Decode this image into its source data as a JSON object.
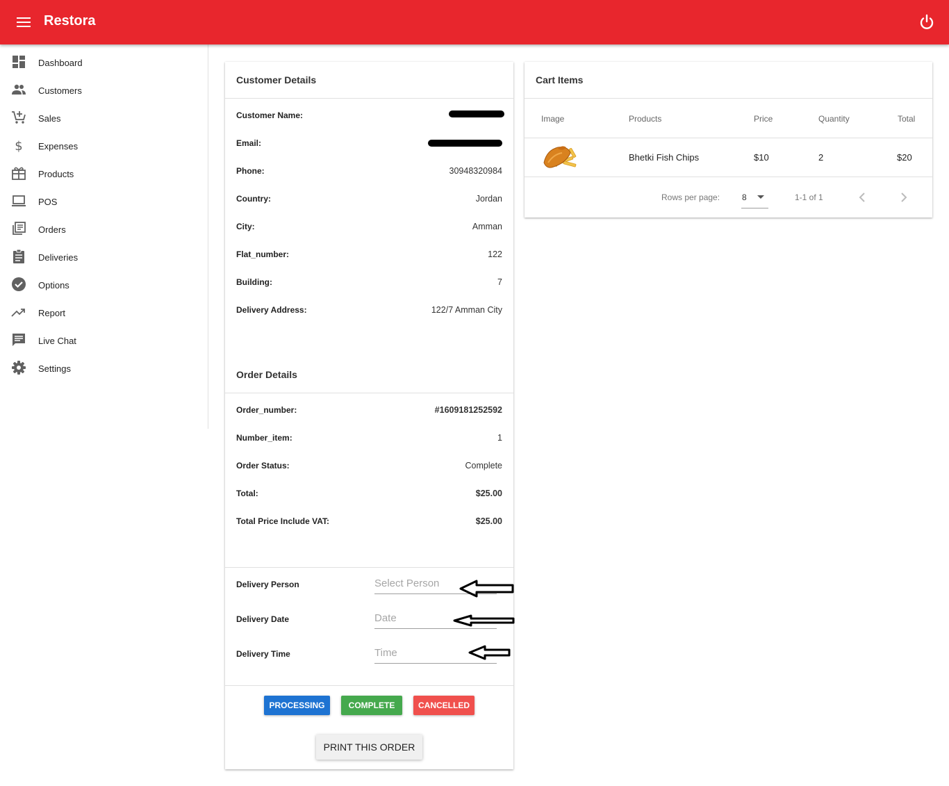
{
  "app": {
    "title": "Restora",
    "icons": {
      "menu": "menu-icon",
      "power": "power-icon"
    }
  },
  "sidebar": {
    "items": [
      {
        "label": "Dashboard",
        "icon": "dashboard-icon"
      },
      {
        "label": "Customers",
        "icon": "customers-icon"
      },
      {
        "label": "Sales",
        "icon": "cart-add-icon"
      },
      {
        "label": "Expenses",
        "icon": "dollar-icon"
      },
      {
        "label": "Products",
        "icon": "gift-box-icon"
      },
      {
        "label": "POS",
        "icon": "laptop-icon"
      },
      {
        "label": "Orders",
        "icon": "library-books-icon"
      },
      {
        "label": "Deliveries",
        "icon": "clipboard-icon"
      },
      {
        "label": "Options",
        "icon": "check-circle-icon"
      },
      {
        "label": "Report",
        "icon": "trending-up-icon"
      },
      {
        "label": "Live Chat",
        "icon": "chat-icon"
      },
      {
        "label": "Settings",
        "icon": "gear-icon"
      }
    ]
  },
  "customer": {
    "title": "Customer Details",
    "rows": [
      {
        "label": "Customer Name:",
        "value": ""
      },
      {
        "label": "Email:",
        "value": ""
      },
      {
        "label": "Phone:",
        "value": "30948320984"
      },
      {
        "label": "Country:",
        "value": "Jordan"
      },
      {
        "label": "City:",
        "value": "Amman"
      },
      {
        "label": "Flat_number:",
        "value": "122"
      },
      {
        "label": "Building:",
        "value": "7"
      },
      {
        "label": "Delivery Address:",
        "value": "122/7 Amman City"
      }
    ]
  },
  "order": {
    "title": "Order Details",
    "rows": [
      {
        "label": "Order_number:",
        "value": "#1609181252592"
      },
      {
        "label": "Number_item:",
        "value": "1"
      },
      {
        "label": "Order Status:",
        "value": "Complete"
      },
      {
        "label": "Total:",
        "value": "$25.00"
      },
      {
        "label": "Total Price Include VAT:",
        "value": "$25.00"
      }
    ]
  },
  "delivery": {
    "person_label": "Delivery Person",
    "person_placeholder": "Select Person",
    "date_label": "Delivery Date",
    "date_placeholder": "Date",
    "time_label": "Delivery Time",
    "time_placeholder": "Time"
  },
  "actions": {
    "processing": "PROCESSING",
    "complete": "COMPLETE",
    "cancelled": "CANCELLED",
    "print": "PRINT THIS ORDER",
    "colors": {
      "processing": "#1e73d2",
      "complete": "#45a94d",
      "cancelled": "#f0504d"
    }
  },
  "cart": {
    "title": "Cart Items",
    "columns": [
      "Image",
      "Products",
      "Price",
      "Quantity",
      "Total"
    ],
    "rows": [
      {
        "image": "fish-chips-image",
        "product": "Bhetki Fish Chips",
        "price": "$10",
        "quantity": "2",
        "total": "$20"
      }
    ],
    "pagination": {
      "rows_per_page_label": "Rows per page:",
      "rows_per_page": "8",
      "range": "1-1 of 1"
    }
  }
}
